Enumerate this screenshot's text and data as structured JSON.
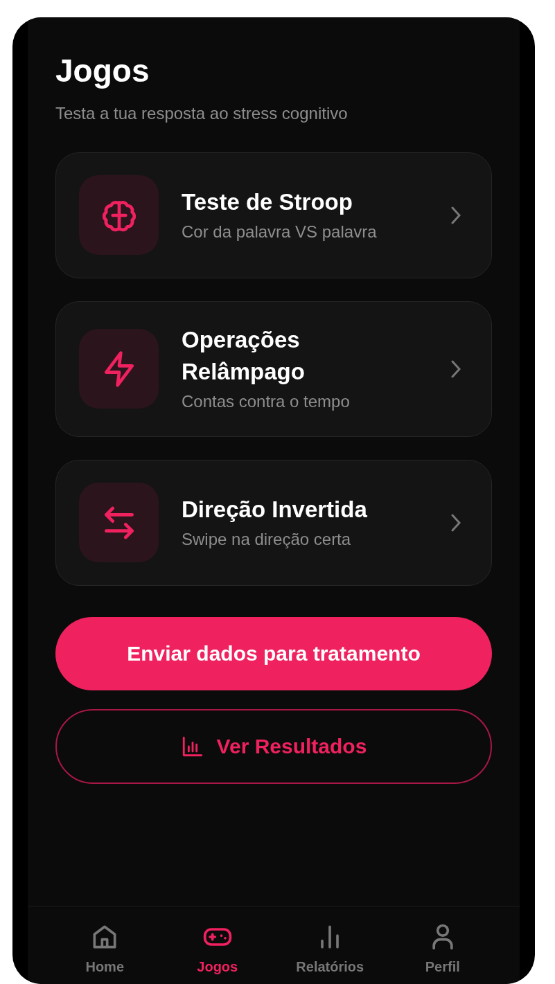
{
  "header": {
    "title": "Jogos",
    "subtitle": "Testa a tua resposta ao stress cognitivo"
  },
  "games": [
    {
      "title": "Teste de Stroop",
      "subtitle": "Cor da palavra VS palavra"
    },
    {
      "title": "Operações Relâmpago",
      "subtitle": "Contas contra o tempo"
    },
    {
      "title": "Direção Invertida",
      "subtitle": "Swipe na direção certa"
    }
  ],
  "actions": [
    {
      "kind": "primary",
      "label": "Enviar dados para tratamento"
    },
    {
      "kind": "outline",
      "label": "Ver Resultados"
    }
  ],
  "tab_bar": [
    {
      "label": "Home",
      "selected": false
    },
    {
      "label": "Jogos",
      "selected": true
    },
    {
      "label": "Relatórios",
      "selected": false
    },
    {
      "label": "Perfil",
      "selected": false
    }
  ]
}
